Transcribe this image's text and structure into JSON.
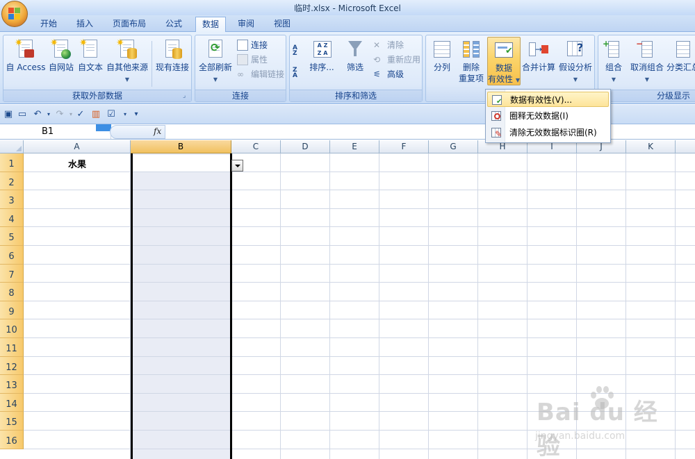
{
  "window": {
    "title": "临时.xlsx - Microsoft Excel"
  },
  "tabs": [
    {
      "label": "开始",
      "active": false
    },
    {
      "label": "插入",
      "active": false
    },
    {
      "label": "页面布局",
      "active": false
    },
    {
      "label": "公式",
      "active": false
    },
    {
      "label": "数据",
      "active": true
    },
    {
      "label": "审阅",
      "active": false
    },
    {
      "label": "视图",
      "active": false
    }
  ],
  "ribbon": {
    "groups": {
      "external_data": {
        "label": "获取外部数据",
        "buttons": [
          "自 Access",
          "自网站",
          "自文本",
          "自其他来源",
          "现有连接"
        ]
      },
      "connections": {
        "label": "连接",
        "refresh_all": "全部刷新",
        "connections": "连接",
        "properties": "属性",
        "edit_links": "编辑链接"
      },
      "sort_filter": {
        "label": "排序和筛选",
        "sort": "排序...",
        "filter": "筛选",
        "clear": "清除",
        "reapply": "重新应用",
        "advanced": "高级"
      },
      "data_tools": {
        "split": "分列",
        "remove_dup_1": "删除",
        "remove_dup_2": "重复项",
        "validation_1": "数据",
        "validation_2": "有效性",
        "consolidate": "合并计算",
        "whatif": "假设分析"
      },
      "outline": {
        "label": "分级显示",
        "group": "组合",
        "ungroup": "取消组合",
        "subtotal": "分类汇总"
      }
    }
  },
  "formula_bar": {
    "name_box": "B1",
    "fx": "fx",
    "content": ""
  },
  "columns": [
    "A",
    "B",
    "C",
    "D",
    "E",
    "F",
    "G",
    "H",
    "I",
    "J",
    "K"
  ],
  "rows": [
    "1",
    "2",
    "3",
    "4",
    "5",
    "6",
    "7",
    "8",
    "9",
    "10",
    "11",
    "12",
    "13",
    "14",
    "15",
    "16"
  ],
  "cells": {
    "A1": "水果"
  },
  "menu": {
    "items": [
      "数据有效性(V)...",
      "圈释无效数据(I)",
      "清除无效数据标识圈(R)"
    ]
  },
  "watermark": {
    "logo": "Bai du 经验",
    "url": "jingyan.baidu.com"
  }
}
